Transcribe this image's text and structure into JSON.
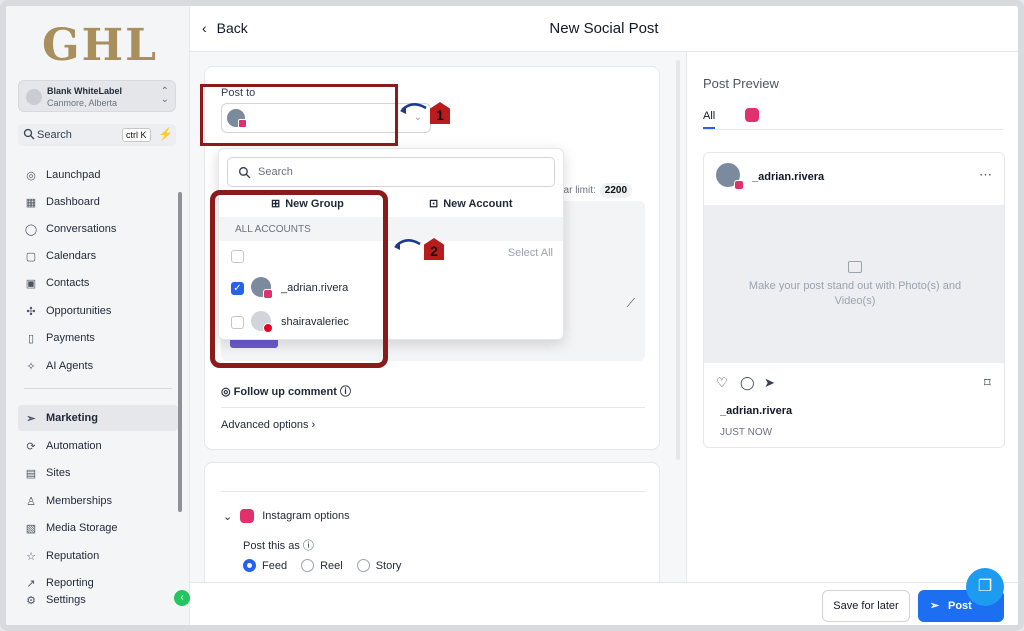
{
  "sidebar": {
    "logo": "GHL",
    "account": {
      "name": "Blank WhiteLabel",
      "location": "Canmore, Alberta"
    },
    "search": {
      "label": "Search",
      "shortcut": "ctrl K"
    },
    "items": [
      {
        "label": "Launchpad",
        "icon": "rocket-icon"
      },
      {
        "label": "Dashboard",
        "icon": "dashboard-icon"
      },
      {
        "label": "Conversations",
        "icon": "chat-icon"
      },
      {
        "label": "Calendars",
        "icon": "calendar-icon"
      },
      {
        "label": "Contacts",
        "icon": "contacts-icon"
      },
      {
        "label": "Opportunities",
        "icon": "opportunities-icon"
      },
      {
        "label": "Payments",
        "icon": "payments-icon"
      },
      {
        "label": "AI Agents",
        "icon": "sparkle-icon"
      },
      {
        "label": "Marketing",
        "icon": "send-icon"
      },
      {
        "label": "Automation",
        "icon": "automation-icon"
      },
      {
        "label": "Sites",
        "icon": "sites-icon"
      },
      {
        "label": "Memberships",
        "icon": "memberships-icon"
      },
      {
        "label": "Media Storage",
        "icon": "media-icon"
      },
      {
        "label": "Reputation",
        "icon": "star-icon"
      },
      {
        "label": "Reporting",
        "icon": "reporting-icon"
      },
      {
        "label": "Settings",
        "icon": "gear-icon"
      }
    ]
  },
  "header": {
    "back_label": "Back",
    "title": "New Social Post"
  },
  "compose": {
    "post_to_label": "Post to",
    "char_limit_label": "har limit:",
    "char_limit_value": "2200",
    "follow_up_label": "Follow up comment",
    "advanced_label": "Advanced options",
    "instagram_options_label": "Instagram options",
    "post_this_as_label": "Post this as",
    "post_types": [
      "Feed",
      "Reel",
      "Story"
    ],
    "selected_post_type": "Feed"
  },
  "dropdown": {
    "search_placeholder": "Search",
    "new_group_label": "New Group",
    "new_account_label": "New Account",
    "section_header": "ALL ACCOUNTS",
    "select_all_label": "Select All",
    "accounts": [
      {
        "name": "_adrian.rivera",
        "checked": true,
        "network": "instagram"
      },
      {
        "name": "shairavaleriec",
        "checked": false,
        "network": "pinterest"
      }
    ]
  },
  "annotations": {
    "marker1": "1",
    "marker2": "2"
  },
  "preview": {
    "title": "Post Preview",
    "tab_all": "All",
    "username": "_adrian.rivera",
    "media_placeholder": "Make your post stand out with Photo(s) and Video(s)",
    "caption_user": "_adrian.rivera",
    "timestamp": "JUST NOW"
  },
  "footer": {
    "save_later_label": "Save for later",
    "post_label": "Post"
  },
  "colors": {
    "accent": "#1d6ff2",
    "annotation_red": "#8b1a1a",
    "instagram": "#e1306c",
    "pinterest": "#e60023",
    "logo_gold": "#a88f5c"
  }
}
